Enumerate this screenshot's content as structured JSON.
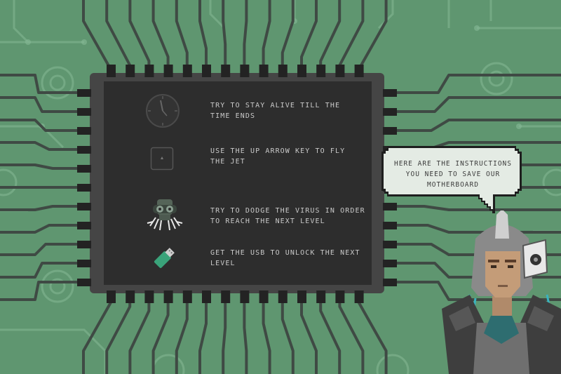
{
  "instructions": [
    {
      "icon": "clock-icon",
      "text": "TRY TO STAY ALIVE TILL THE TIME ENDS"
    },
    {
      "icon": "up-arrow-key-icon",
      "text": "USE THE UP ARROW KEY TO FLY THE JET"
    },
    {
      "icon": "virus-icon",
      "text": "TRY TO DODGE THE VIRUS IN ORDER TO REACH THE NEXT LEVEL"
    },
    {
      "icon": "usb-icon",
      "text": "GET THE USB TO UNLOCK THE NEXT LEVEL"
    }
  ],
  "bubble": {
    "text": "HERE ARE THE INSTRUCTIONS YOU NEED TO SAVE OUR MOTHERBOARD"
  },
  "colors": {
    "background": "#5f9670",
    "trace": "#3f4a44",
    "trace_light": "#8fc39c",
    "panel": "#2d2d2d",
    "chip_border": "#444444",
    "pin": "#232323",
    "text": "#c9c9c9",
    "bubble_fill": "#e4ebe4",
    "bubble_border": "#1e1e1e"
  }
}
